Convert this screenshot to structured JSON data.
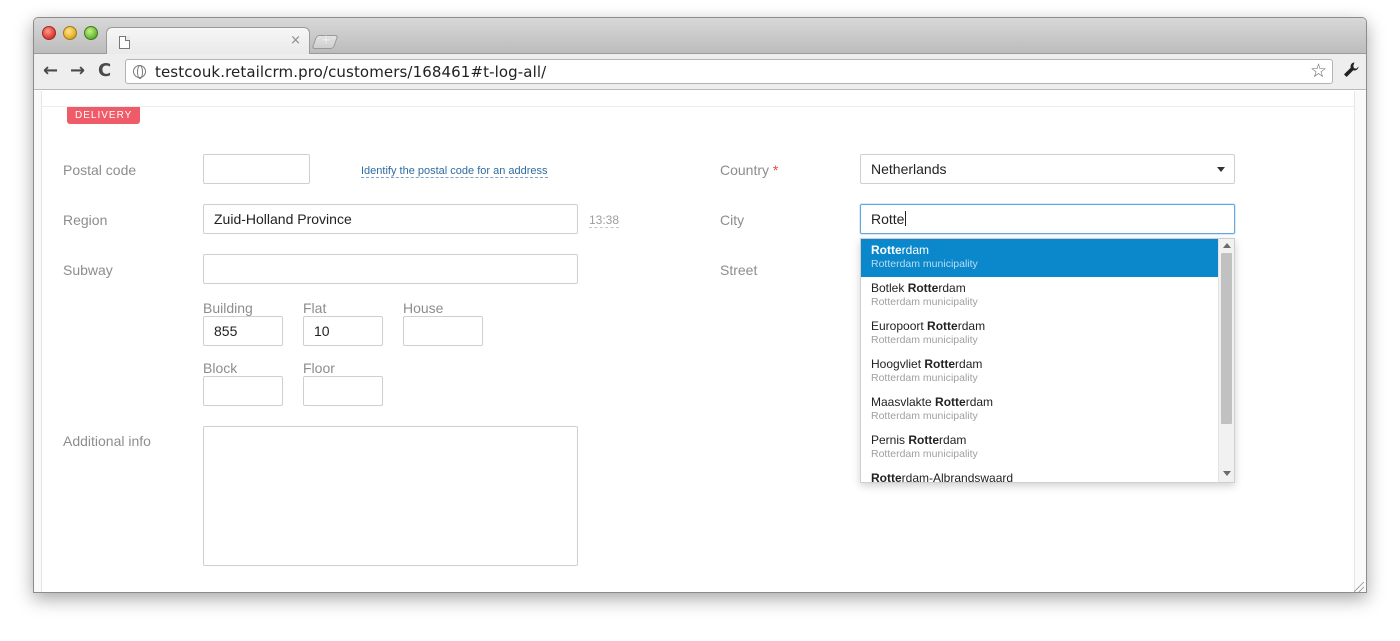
{
  "browser": {
    "tab_close": "×",
    "new_tab": "+",
    "url": "testcouk.retailcrm.pro/customers/168461#t-log-all/",
    "nav": {
      "back": "←",
      "forward": "→",
      "reload": "C"
    },
    "star": "☆",
    "wrench": "🔧"
  },
  "section": {
    "badge": "DELIVERY"
  },
  "left": {
    "postal_code": {
      "label": "Postal code",
      "value": "",
      "helper": "Identify the postal code for an address"
    },
    "region": {
      "label": "Region",
      "value": "Zuid-Holland Province",
      "time": "13:38"
    },
    "subway": {
      "label": "Subway",
      "value": ""
    },
    "building": {
      "label": "Building",
      "value": "855"
    },
    "flat": {
      "label": "Flat",
      "value": "10"
    },
    "house": {
      "label": "House",
      "value": ""
    },
    "block": {
      "label": "Block",
      "value": ""
    },
    "floor": {
      "label": "Floor",
      "value": ""
    },
    "additional_info": {
      "label": "Additional info",
      "value": ""
    }
  },
  "right": {
    "country": {
      "label": "Country",
      "required_mark": "*",
      "value": "Netherlands"
    },
    "city": {
      "label": "City",
      "value": "Rotte"
    },
    "street": {
      "label": "Street"
    }
  },
  "city_suggestions": [
    {
      "pre": "",
      "match": "Rotte",
      "post": "rdam",
      "sub": "Rotterdam municipality",
      "active": true
    },
    {
      "pre": "Botlek ",
      "match": "Rotte",
      "post": "rdam",
      "sub": "Rotterdam municipality",
      "active": false
    },
    {
      "pre": "Europoort ",
      "match": "Rotte",
      "post": "rdam",
      "sub": "Rotterdam municipality",
      "active": false
    },
    {
      "pre": "Hoogvliet ",
      "match": "Rotte",
      "post": "rdam",
      "sub": "Rotterdam municipality",
      "active": false
    },
    {
      "pre": "Maasvlakte ",
      "match": "Rotte",
      "post": "rdam",
      "sub": "Rotterdam municipality",
      "active": false
    },
    {
      "pre": "Pernis ",
      "match": "Rotte",
      "post": "rdam",
      "sub": "Rotterdam municipality",
      "active": false
    },
    {
      "pre": "",
      "match": "Rotte",
      "post": "rdam-Albrandswaard",
      "sub": "",
      "active": false
    }
  ]
}
